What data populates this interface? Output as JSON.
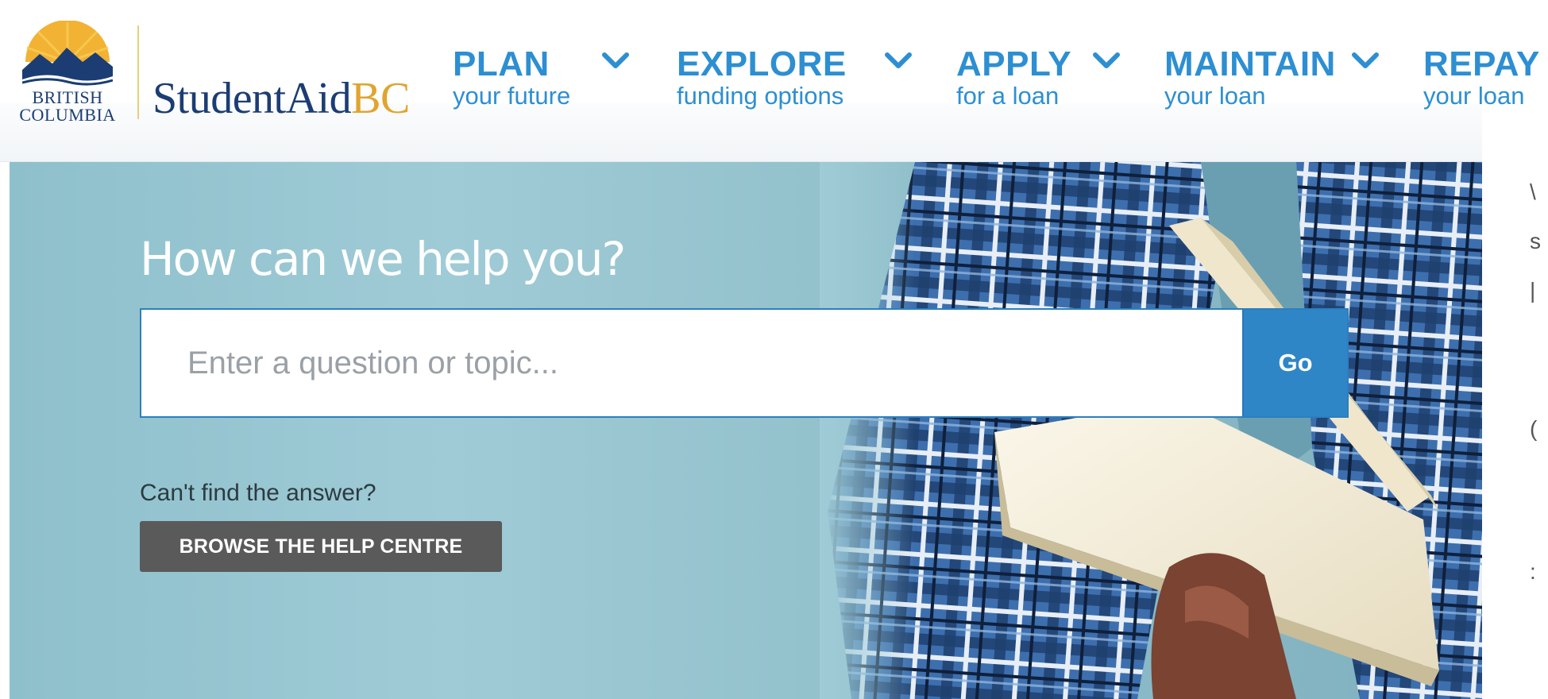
{
  "logo": {
    "province_line1": "BRITISH",
    "province_line2": "COLUMBIA",
    "brand_main": "StudentAid",
    "brand_accent": "BC"
  },
  "nav": [
    {
      "main": "PLAN",
      "sub": "your future",
      "icon": "chevron-down-icon"
    },
    {
      "main": "EXPLORE",
      "sub": "funding options",
      "icon": "chevron-down-icon"
    },
    {
      "main": "APPLY",
      "sub": "for a loan",
      "icon": "chevron-down-icon"
    },
    {
      "main": "MAINTAIN",
      "sub": "your loan",
      "icon": "chevron-down-icon"
    },
    {
      "main": "REPAY",
      "sub": "your loan",
      "icon": "chevron-down-icon"
    }
  ],
  "hero": {
    "title": "How can we help you?",
    "search_placeholder": "Enter a question or topic...",
    "search_value": "",
    "go_label": "Go",
    "cant_find": "Can't find the answer?",
    "browse_label": "BROWSE THE HELP CENTRE"
  },
  "colors": {
    "nav_blue": "#2d8fd2",
    "brand_navy": "#1c3d73",
    "brand_gold": "#e0a52f",
    "go_button": "#2f86c6",
    "browse_button": "#5a5a5a"
  }
}
